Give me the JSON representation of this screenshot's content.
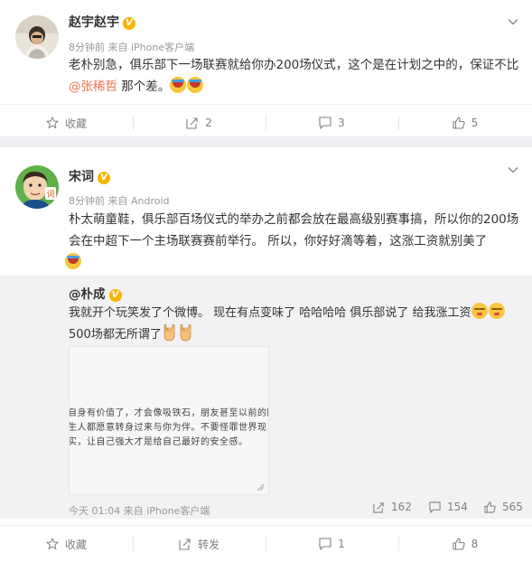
{
  "post1": {
    "username": "赵宇赵宇",
    "verified_icon": "V",
    "meta": "8分钟前 来自 iPhone客户端",
    "text_before": "老朴别急，俱乐部下一场联赛就给你办200场仪式，这个是在计划之中的，保证不比",
    "mention": "@张稀哲",
    "text_after": " 那个差。",
    "actions": {
      "favorite": "收藏",
      "repost": "2",
      "comment": "3",
      "like": "5"
    }
  },
  "post2": {
    "username": "宋词",
    "verified_icon": "V",
    "meta": "8分钟前 来自 Android",
    "text": "朴太萌童鞋，俱乐部百场仪式的举办之前都会放在最高级别赛事搞，所以你的200场会在中超下一个主场联赛赛前举行。 所以，你好好滴等着，这涨工资就别美了",
    "repost": {
      "username": "@朴成",
      "verified_icon": "V",
      "text_part1": "我就开个玩笑发了个微博。 现在有点变味了 哈哈哈哈 俱乐部说了 给我涨工资",
      "text_part2": "500场都无所谓了",
      "image_lines": [
        "自身有价值了，才会像吸铁石，朋友甚至以前的陌",
        "生人都愿意转身过来与你为伴。不要怪罪世界现",
        "实，让自己强大才是给自己最好的安全感。"
      ],
      "meta": "今天 01:04 来自 iPhone客户端",
      "repost_count": "162",
      "comment_count": "154",
      "like_count": "565"
    },
    "actions": {
      "favorite": "收藏",
      "repost": "转发",
      "comment": "1",
      "like": "8"
    }
  },
  "colors": {
    "mention": "#eb7350",
    "verified": "#f7b500",
    "divider": "#eef0f3",
    "repost_bg": "#f2f2f5"
  },
  "icons": [
    "star-icon",
    "repost-icon",
    "comment-icon",
    "thumbs-up-icon",
    "chevron-down-icon",
    "verified-icon",
    "emoji-laugh-cry",
    "emoji-sleepy",
    "emoji-rock-hand"
  ]
}
